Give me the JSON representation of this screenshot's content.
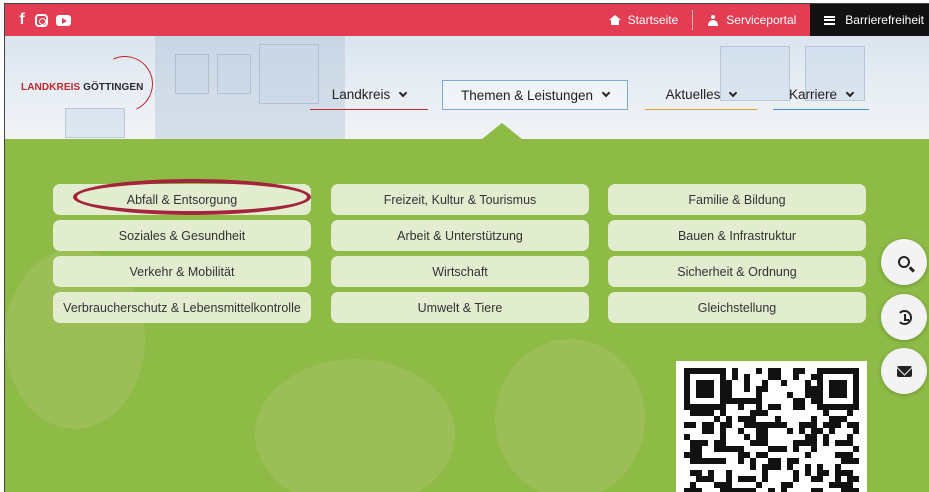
{
  "social": {
    "facebook_icon": "facebook-icon",
    "instagram_icon": "instagram-icon",
    "youtube_icon": "youtube-icon"
  },
  "toplinks": {
    "home": "Startseite",
    "service": "Serviceportal",
    "accessibility": "Barrierefreiheit"
  },
  "brand": {
    "part1": "LANDKREIS",
    "part2": "GÖTTINGEN",
    "red": "#c1272d"
  },
  "nav": {
    "items": [
      {
        "label": "Landkreis",
        "underline": "#c1272d"
      },
      {
        "label": "Themen & Leistungen",
        "underline": "#8dbb45"
      },
      {
        "label": "Aktuelles",
        "underline": "#e0a030"
      },
      {
        "label": "Karriere",
        "underline": "#4a90c8"
      }
    ]
  },
  "topics": {
    "col1": [
      "Abfall & Entsorgung",
      "Soziales & Gesundheit",
      "Verkehr & Mobilität",
      "Verbraucherschutz & Lebensmittelkontrolle"
    ],
    "col2": [
      "Freizeit, Kultur & Tourismus",
      "Arbeit & Unterstützung",
      "Wirtschaft",
      "Umwelt & Tiere"
    ],
    "col3": [
      "Familie & Bildung",
      "Bauen & Infrastruktur",
      "Sicherheit & Ordnung",
      "Gleichstellung"
    ]
  },
  "colors": {
    "topbar": "#e23d52",
    "panel": "#8dbb45",
    "tile": "#e2ecce",
    "highlight": "#a4253b"
  },
  "tools": [
    "search-icon",
    "history-icon",
    "mail-icon"
  ]
}
